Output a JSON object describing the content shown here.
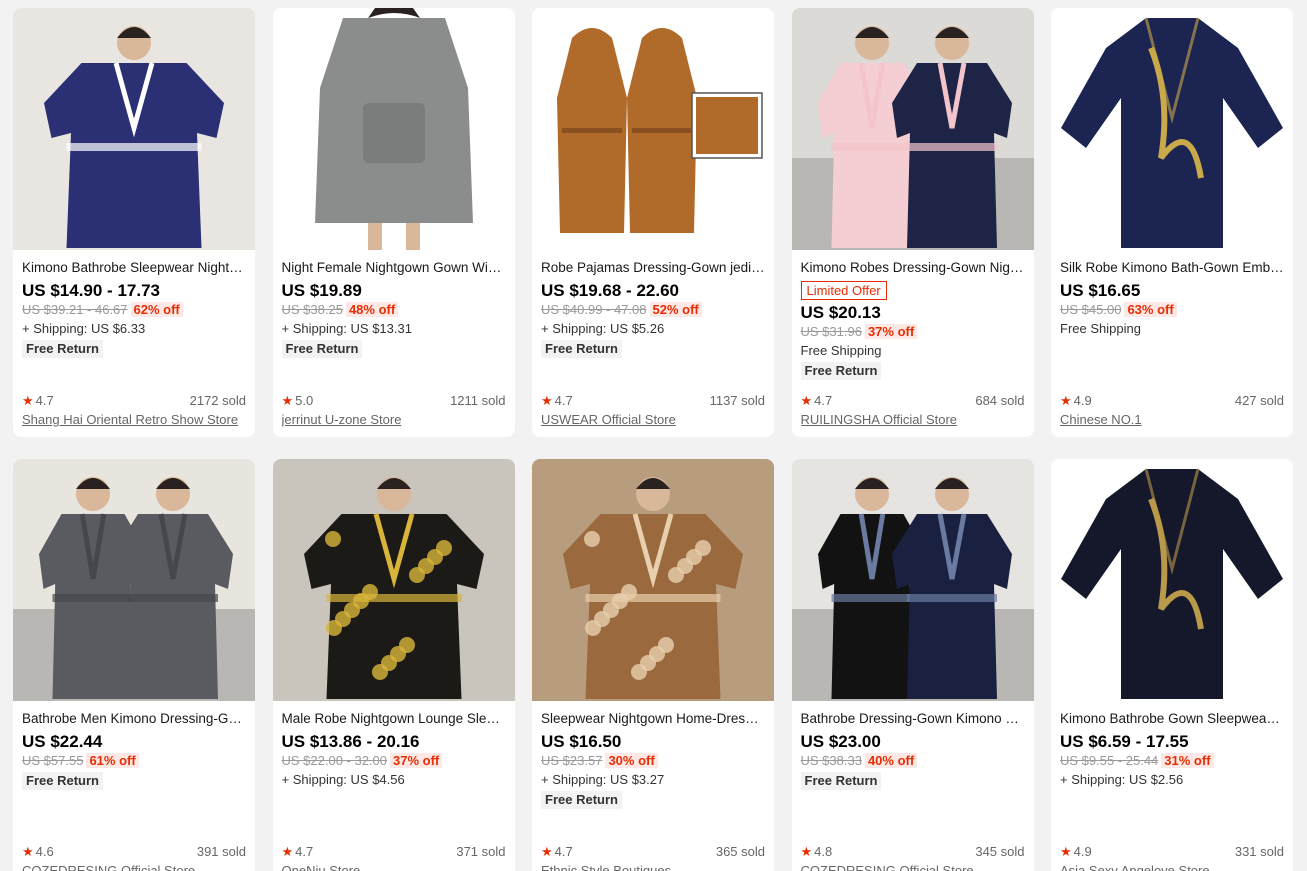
{
  "products": [
    {
      "title": "Kimono Bathrobe Sleepwear Nighty Men Flannel Robe",
      "badge": "",
      "price": "US $14.90 - 17.73",
      "old_price": "US $39.21 - 46.67",
      "discount": "62% off",
      "shipping": "+ Shipping: US $6.33",
      "free_return": "Free Return",
      "rating": "4.7",
      "sold": "2172 sold",
      "store": "Shang Hai Oriental Retro Show Store",
      "image": {
        "bg": "#e9e6e2",
        "robe": "#2b2f73",
        "trim": "#ffffff",
        "icon": "man-in-navy-robe"
      }
    },
    {
      "title": "Night Female Nightgown Gown Winter Hoodie",
      "badge": "",
      "price": "US $19.89",
      "old_price": "US $38.25",
      "discount": "48% off",
      "shipping": "+ Shipping: US $13.31",
      "free_return": "Free Return",
      "rating": "5.0",
      "sold": "1211 sold",
      "store": "jerrinut U-zone Store",
      "image": {
        "bg": "#ffffff",
        "robe": "#8a8d8b",
        "trim": "#7a7d7b",
        "icon": "grey-hoodie-blanket"
      }
    },
    {
      "title": "Robe Pajamas Dressing-Gown jedi Bathrobe",
      "badge": "",
      "price": "US $19.68 - 22.60",
      "old_price": "US $40.99 - 47.08",
      "discount": "52% off",
      "shipping": "+ Shipping: US $5.26",
      "free_return": "Free Return",
      "rating": "4.7",
      "sold": "1137 sold",
      "store": "USWEAR Official Store",
      "image": {
        "bg": "#ffffff",
        "robe": "#b06a2a",
        "trim": "#8a5020",
        "icon": "brown-hooded-robe"
      }
    },
    {
      "title": "Kimono Robes Dressing-Gown Nightgown Couple",
      "badge": "Limited Offer",
      "price": "US $20.13",
      "old_price": "US $31.96",
      "discount": "37% off",
      "shipping": "Free Shipping",
      "free_return": "Free Return",
      "rating": "4.7",
      "sold": "684 sold",
      "store": "RUILINGSHA Official Store",
      "image": {
        "bg": "#dcdad6",
        "robe": "#1d2445",
        "trim": "#f3c4cb",
        "icon": "couple-pink-navy-robes"
      }
    },
    {
      "title": "Silk Robe Kimono Bath-Gown Embroidery Dragon",
      "badge": "",
      "price": "US $16.65",
      "old_price": "US $45.00",
      "discount": "63% off",
      "shipping": "Free Shipping",
      "free_return": "",
      "rating": "4.9",
      "sold": "427 sold",
      "store": "Chinese NO.1",
      "image": {
        "bg": "#ffffff",
        "robe": "#1c2552",
        "trim": "#c9a94a",
        "icon": "dragon-silk-robe"
      }
    },
    {
      "title": "Bathrobe Men Kimono Dressing-Gown Couple",
      "badge": "",
      "price": "US $22.44",
      "old_price": "US $57.55",
      "discount": "61% off",
      "shipping": "",
      "free_return": "Free Return",
      "rating": "4.6",
      "sold": "391 sold",
      "store": "COZEDRESING Official Store",
      "image": {
        "bg": "#e8e4de",
        "robe": "#5a5b60",
        "trim": "#46474c",
        "icon": "couple-grey-robes"
      }
    },
    {
      "title": "Male Robe Nightgown Lounge Sleepwear Dragon",
      "badge": "",
      "price": "US $13.86 - 20.16",
      "old_price": "US $22.00 - 32.00",
      "discount": "37% off",
      "shipping": "+ Shipping: US $4.56",
      "free_return": "",
      "rating": "4.7",
      "sold": "371 sold",
      "store": "OneNiu Store",
      "image": {
        "bg": "#c9c4bc",
        "robe": "#1b1a16",
        "trim": "#d8b53a",
        "icon": "man-dragon-print-robe"
      }
    },
    {
      "title": "Sleepwear Nightgown Home-Dressing Gown Satin",
      "badge": "",
      "price": "US $16.50",
      "old_price": "US $23.57",
      "discount": "30% off",
      "shipping": "+ Shipping: US $3.27",
      "free_return": "Free Return",
      "rating": "4.7",
      "sold": "365 sold",
      "store": "Ethnic Style Boutiques",
      "image": {
        "bg": "#b89c7e",
        "robe": "#9a6a3e",
        "trim": "#e8cfae",
        "icon": "man-paisley-satin-robe"
      }
    },
    {
      "title": "Bathrobe Dressing-Gown Kimono Couple Plaid",
      "badge": "",
      "price": "US $23.00",
      "old_price": "US $38.33",
      "discount": "40% off",
      "shipping": "",
      "free_return": "Free Return",
      "rating": "4.8",
      "sold": "345 sold",
      "store": "COZEDRESING Official Store",
      "image": {
        "bg": "#e6e4e0",
        "robe": "#1a2140",
        "trim": "#6a7aa0",
        "icon": "couple-plaid-robes"
      }
    },
    {
      "title": "Kimono Bathrobe Gown Sleepwear Embroidery",
      "badge": "",
      "price": "US $6.59 - 17.55",
      "old_price": "US $9.55 - 25.44",
      "discount": "31% off",
      "shipping": "+ Shipping: US $2.56",
      "free_return": "",
      "rating": "4.9",
      "sold": "331 sold",
      "store": "Asia Sexy Angelove Store",
      "image": {
        "bg": "#ffffff",
        "robe": "#15182a",
        "trim": "#b89a4a",
        "icon": "black-dragon-kimono"
      }
    }
  ],
  "star_glyph": "★"
}
